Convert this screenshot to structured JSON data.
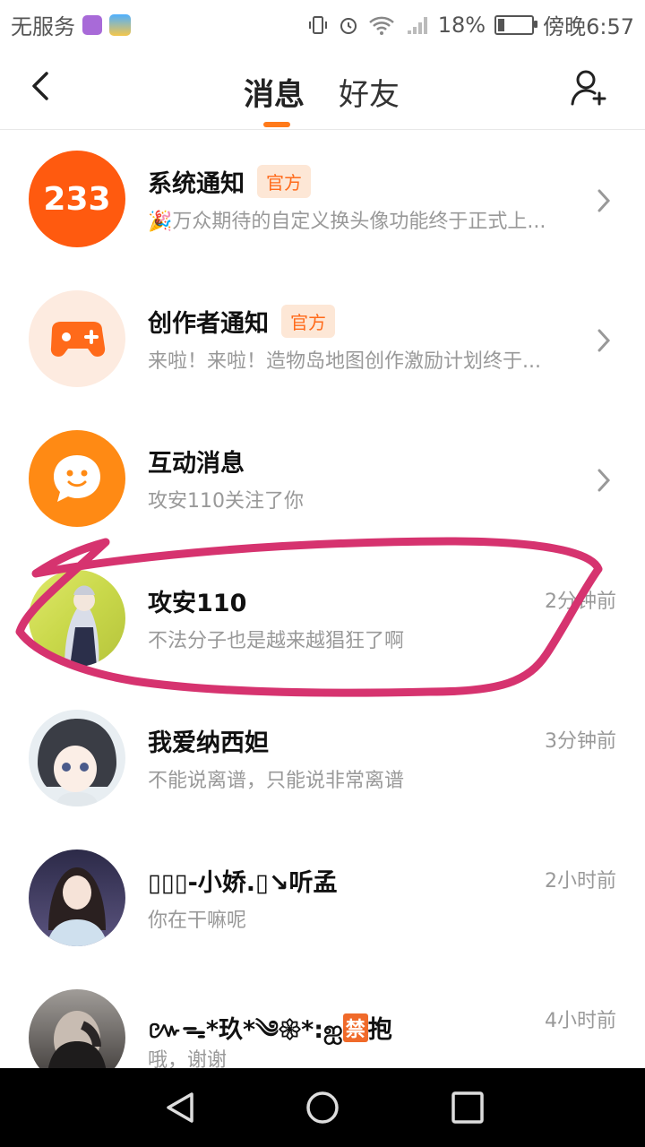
{
  "status_bar": {
    "carrier": "无服务",
    "battery_percent": "18%",
    "battery_level": 0.18,
    "time": "傍晚6:57"
  },
  "header": {
    "tabs": [
      {
        "label": "消息",
        "active": true
      },
      {
        "label": "好友",
        "active": false
      }
    ],
    "accent_color": "#ff7a1a"
  },
  "messages": [
    {
      "title": "系统通知",
      "badge": "官方",
      "preview": "🎉万众期待的自定义换头像功能终于正式上...",
      "avatar_text": "233",
      "avatar_icon": "233-logo-icon"
    },
    {
      "title": "创作者通知",
      "badge": "官方",
      "preview": "来啦！来啦！造物岛地图创作激励计划终于...",
      "avatar_icon": "gamepad-plus-icon"
    },
    {
      "title": "互动消息",
      "preview": "攻安110关注了你",
      "avatar_icon": "chat-bubble-smile-icon"
    },
    {
      "title": "攻安110",
      "preview": "不法分子也是越来越猖狂了啊",
      "time": "2分钟前"
    },
    {
      "title": "我爱纳西妲",
      "preview": "不能说离谱，只能说非常离谱",
      "time": "3分钟前"
    },
    {
      "title": "▯▯▯-小娇.▯↘听孟",
      "preview": "你在干嘛呢",
      "time": "2小时前"
    },
    {
      "title": "៚ᯓ*玖*༄𑁍*:ஐ",
      "title_badge": "禁",
      "title_suffix": "抱",
      "preview": "哦，谢谢",
      "time": "4小时前"
    }
  ],
  "annotation": {
    "color": "#d6336f"
  }
}
